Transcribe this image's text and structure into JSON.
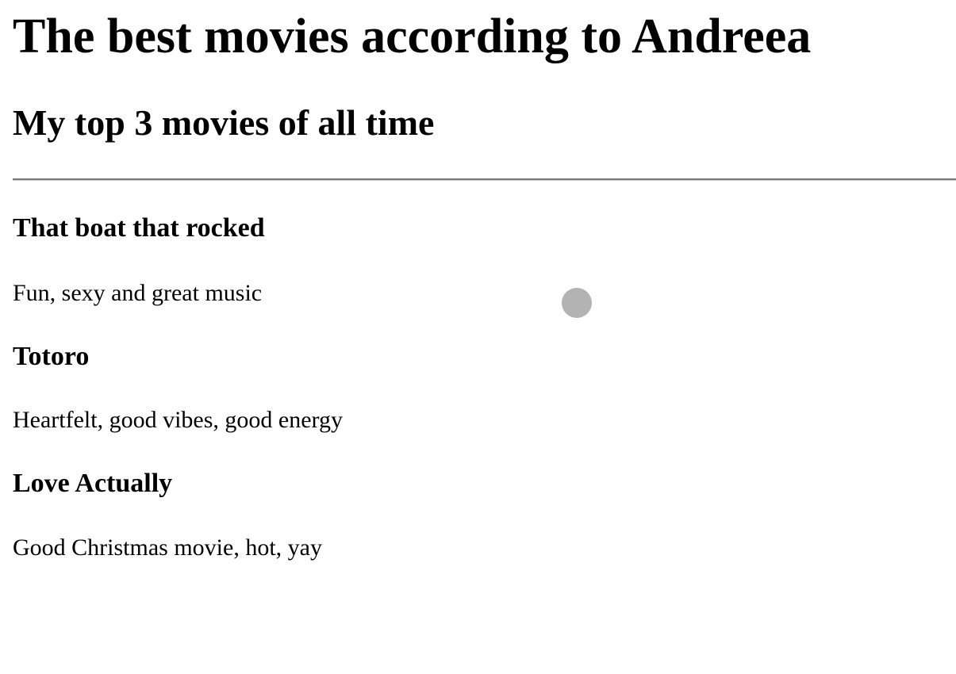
{
  "page": {
    "title": "The best movies according to Andreea",
    "subtitle": "My top 3 movies of all time"
  },
  "movies": [
    {
      "title": "That boat that rocked",
      "description": "Fun, sexy and great music"
    },
    {
      "title": "Totoro",
      "description": "Heartfelt, good vibes, good energy"
    },
    {
      "title": "Love Actually",
      "description": "Good Christmas movie, hot, yay"
    }
  ],
  "cursor": {
    "color": "#b3b3b3"
  }
}
